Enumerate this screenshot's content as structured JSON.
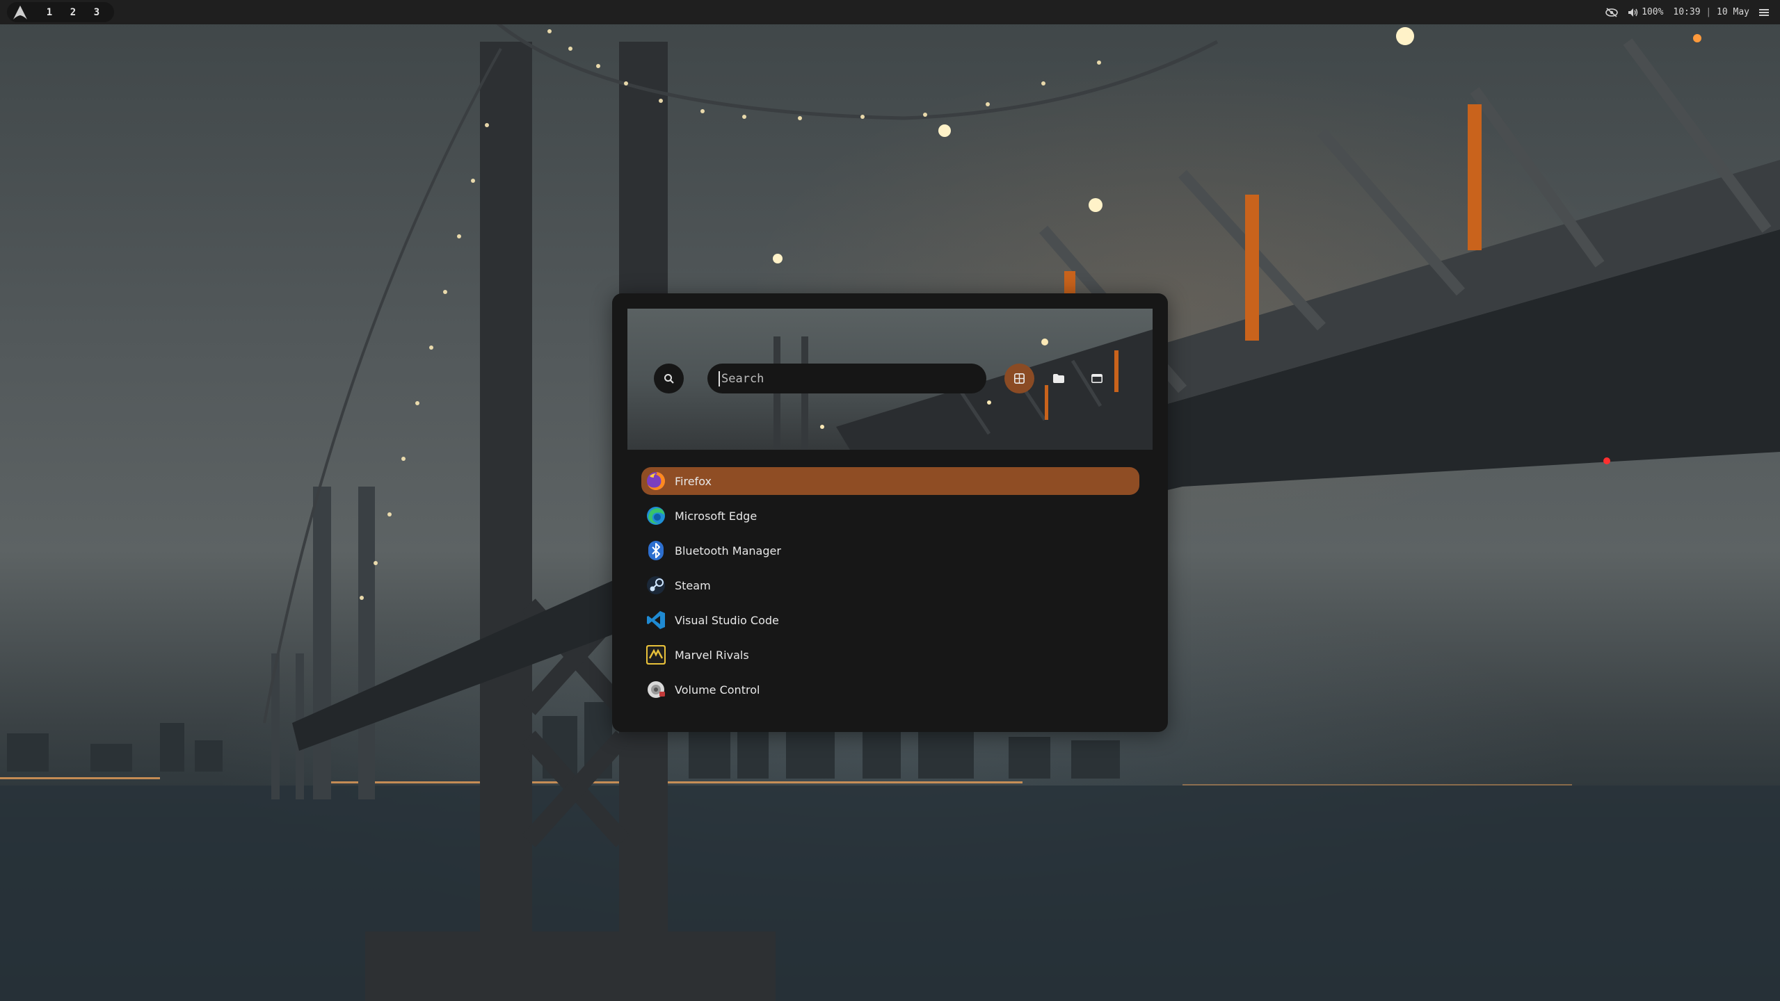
{
  "topbar": {
    "workspaces": [
      "1",
      "2",
      "3"
    ],
    "tray": {
      "volume": "100%",
      "time": "10:39",
      "separator": "|",
      "date": "10 May"
    }
  },
  "launcher": {
    "search": {
      "placeholder": "Search",
      "value": ""
    },
    "modes": [
      "apps-grid-icon",
      "folder-icon",
      "window-icon"
    ],
    "apps": [
      {
        "label": "Firefox",
        "icon": "firefox-icon",
        "selected": true
      },
      {
        "label": "Microsoft Edge",
        "icon": "edge-icon"
      },
      {
        "label": "Bluetooth Manager",
        "icon": "bluetooth-icon"
      },
      {
        "label": "Steam",
        "icon": "steam-icon"
      },
      {
        "label": "Visual Studio Code",
        "icon": "vscode-icon"
      },
      {
        "label": "Marvel Rivals",
        "icon": "marvel-rivals-icon"
      },
      {
        "label": "Volume Control",
        "icon": "volume-control-icon"
      }
    ]
  },
  "colors": {
    "accent": "#8f4d24",
    "panel": "#171717",
    "bar": "#1f1f1f"
  }
}
